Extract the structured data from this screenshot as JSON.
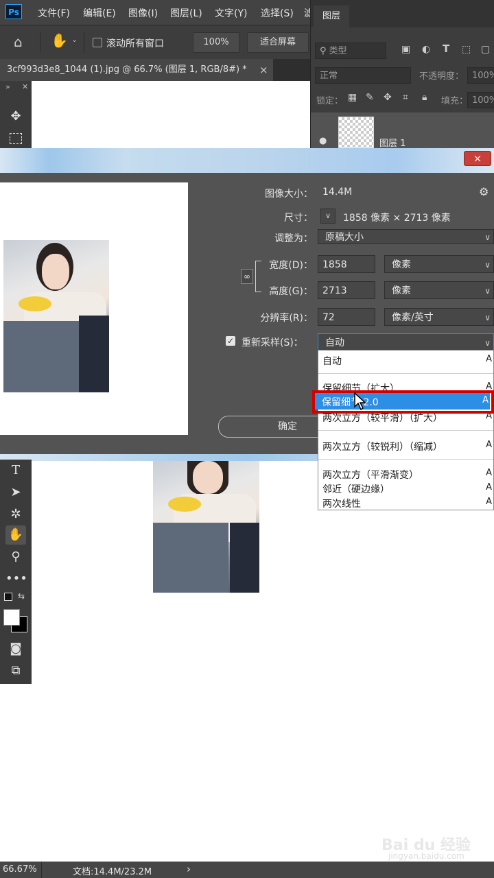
{
  "app": {
    "logo": "Ps"
  },
  "menu": [
    "文件(F)",
    "编辑(E)",
    "图像(I)",
    "图层(L)",
    "文字(Y)",
    "选择(S)",
    "滤"
  ],
  "options_bar": {
    "scroll_all_label": "滚动所有窗口",
    "zoom_value": "100%",
    "fit_screen_label": "适合屏幕"
  },
  "document_tab": {
    "title": "3cf993d3e8_1044 (1).jpg @ 66.7% (图层 1, RGB/8#) *",
    "close": "×"
  },
  "layers_panel": {
    "tab": "图层",
    "filter_placeholder": "类型",
    "blend_mode": "正常",
    "opacity_label": "不透明度：",
    "opacity_value": "100%",
    "lock_label": "锁定：",
    "fill_label": "填充：",
    "fill_value": "100%",
    "layer_name": "图层 1"
  },
  "dialog": {
    "image_size_label": "图像大小：",
    "image_size_value": "14.4M",
    "dimensions_label": "尺寸：",
    "dimensions_value": "1858 像素  ×  2713 像素",
    "fit_to_label": "调整为：",
    "fit_to_value": "原稿大小",
    "width_label": "宽度(D)：",
    "width_value": "1858",
    "width_unit": "像素",
    "height_label": "高度(G)：",
    "height_value": "2713",
    "height_unit": "像素",
    "resolution_label": "分辨率(R)：",
    "resolution_value": "72",
    "resolution_unit": "像素/英寸",
    "resample_label": "重新采样(S)：",
    "resample_checked": true,
    "resample_value": "自动",
    "ok_label": "确定",
    "close": "×"
  },
  "resample_dropdown": {
    "items": [
      {
        "label": "自动",
        "key": "A"
      },
      {
        "label": "保留细节（扩大）",
        "key": "A"
      },
      {
        "label": "保留细节 2.0",
        "key": "A",
        "selected": true
      },
      {
        "label": "两次立方（较平滑）（扩大）",
        "key": "A"
      },
      {
        "label": "两次立方（较锐利）（缩减）",
        "key": "A"
      },
      {
        "label": "两次立方（平滑渐变）",
        "key": "A"
      },
      {
        "label": "邻近（硬边缘）",
        "key": "A"
      },
      {
        "label": "两次线性",
        "key": "A"
      }
    ]
  },
  "status_bar": {
    "zoom": "66.67%",
    "doc_info": "文档:14.4M/23.2M",
    "arrow": "›"
  },
  "watermark": {
    "brand": "Bai du 经验",
    "url": "jingyan.baidu.com"
  },
  "colors": {
    "accent_blue": "#2d8ee6",
    "highlight_red": "#d40000",
    "panel_bg": "#535353"
  }
}
